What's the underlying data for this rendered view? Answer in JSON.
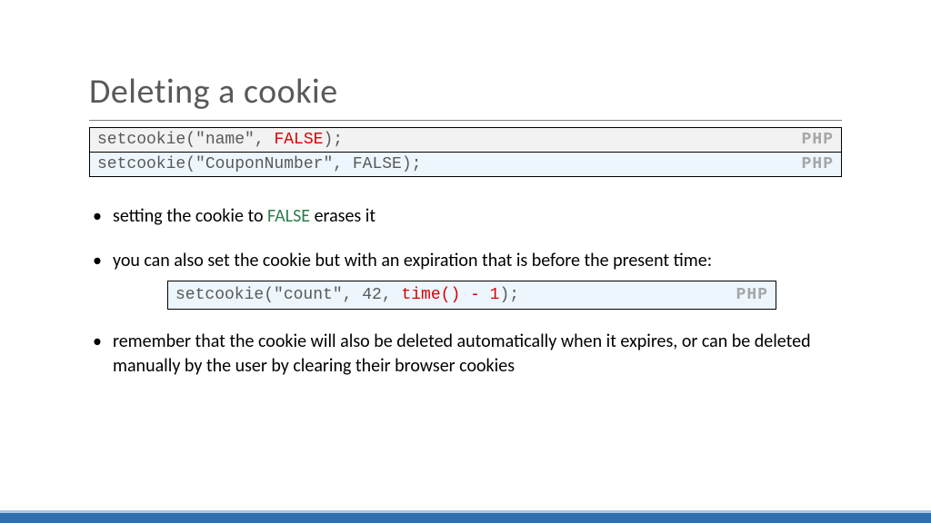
{
  "title": "Deleting a cookie",
  "code1": {
    "line1_pre": "setcookie(\"name\", ",
    "line1_kw": "FALSE",
    "line1_post": ");",
    "lang": "PHP",
    "line2": "setcookie(\"CouponNumber\", FALSE);",
    "lang2": "PHP"
  },
  "bullets": {
    "b1_pre": "setting the cookie to ",
    "b1_kw": "FALSE",
    "b1_post": " erases it",
    "b2": "you can also set the cookie but with an expiration that is before the present time:",
    "b3": "remember that the cookie will also be deleted automatically when it expires, or can be deleted manually by the user by clearing their browser cookies"
  },
  "code2": {
    "pre": "setcookie(\"count\", 42, ",
    "kw": "time() - 1",
    "post": ");",
    "lang": "PHP"
  }
}
